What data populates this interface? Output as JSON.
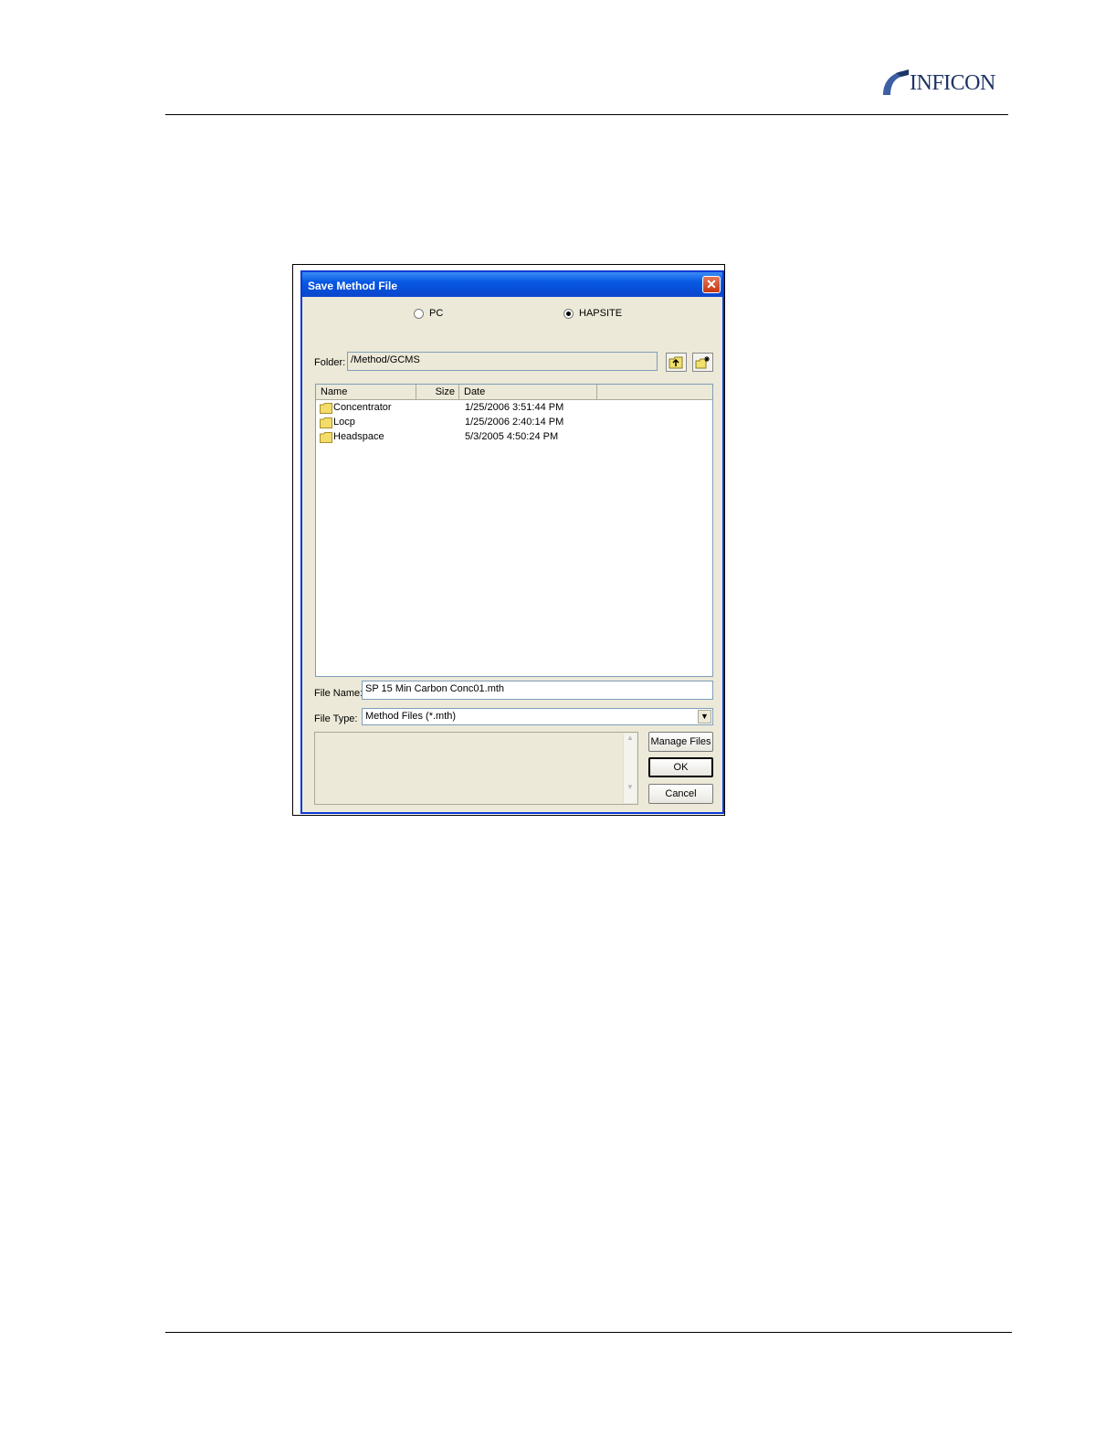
{
  "logo": {
    "text": "INFICON"
  },
  "dialog": {
    "title": "Save Method File",
    "close_glyph": "✕",
    "radio_pc": "PC",
    "radio_hapsite": "HAPSITE",
    "selected_radio": "HAPSITE",
    "folder_label": "Folder:",
    "folder_value": "/Method/GCMS",
    "columns": [
      "Name",
      "Size",
      "Date"
    ],
    "rows": [
      {
        "name": "Concentrator",
        "size": "",
        "date": "1/25/2006 3:51:44 PM"
      },
      {
        "name": "Locp",
        "size": "",
        "date": "1/25/2006 2:40:14 PM"
      },
      {
        "name": "Headspace",
        "size": "",
        "date": "5/3/2005 4:50:24 PM"
      }
    ],
    "file_name_label": "File Name:",
    "file_name_value": "SP 15 Min Carbon Conc01.mth",
    "file_type_label": "File Type:",
    "file_type_value": "Method Files (*.mth)",
    "manage_files": "Manage Files",
    "ok": "OK",
    "cancel": "Cancel"
  },
  "icons": [
    "folder-up-icon",
    "new-folder-icon",
    "folder-icon",
    "close-icon",
    "chevron-down-icon"
  ],
  "colors": {
    "titlebar": "#0758e3",
    "dialog_bg": "#ece9d8",
    "logo": "#1f3466"
  }
}
